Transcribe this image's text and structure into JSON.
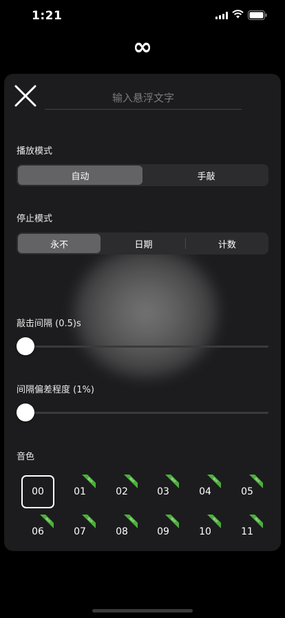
{
  "status": {
    "time": "1:21"
  },
  "header": {
    "symbol": "∞"
  },
  "input": {
    "placeholder": "输入悬浮文字"
  },
  "play_mode": {
    "label": "播放模式",
    "options": [
      "自动",
      "手敲"
    ],
    "selected": 0
  },
  "stop_mode": {
    "label": "停止模式",
    "options": [
      "永不",
      "日期",
      "计数"
    ],
    "selected": 0
  },
  "interval": {
    "label": "敲击间隔 (0.5)s",
    "value": 0.5
  },
  "deviation": {
    "label": "间隔偏差程度 (1%)",
    "value": 1
  },
  "tones": {
    "label": "音色",
    "items": [
      "00",
      "01",
      "02",
      "03",
      "04",
      "05",
      "06",
      "07",
      "08",
      "09",
      "10",
      "11"
    ],
    "selected": "00",
    "badge": "BUY",
    "badge_color": "#4caf3a"
  }
}
